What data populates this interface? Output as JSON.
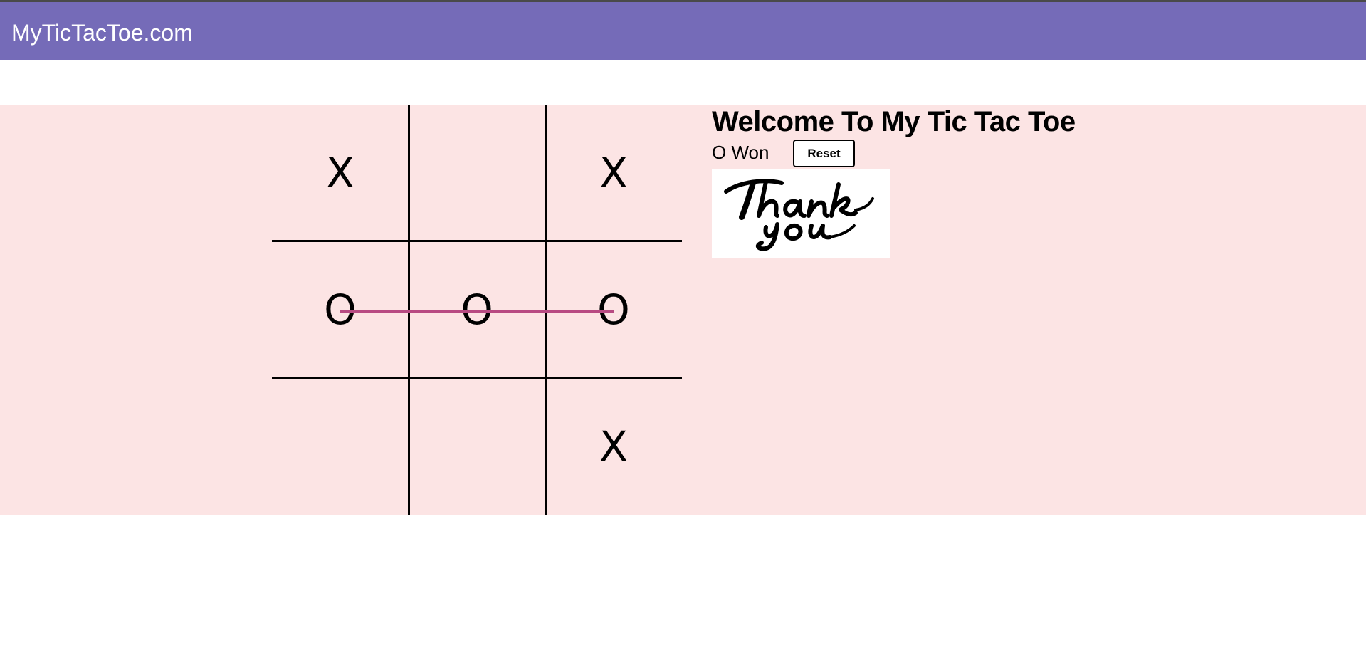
{
  "navbar": {
    "brand": "MyTicTacToe.com",
    "color": "#756bb8"
  },
  "content": {
    "background": "#fce4e4"
  },
  "game": {
    "board": [
      [
        "X",
        "",
        "X"
      ],
      [
        "O",
        "O",
        "O"
      ],
      [
        "",
        "",
        "X"
      ]
    ],
    "winning_row": 1,
    "win_line_color": "#b84a82"
  },
  "panel": {
    "title": "Welcome To My Tic Tac Toe",
    "status": "O Won",
    "reset_label": "Reset",
    "image_text": "thank you"
  }
}
